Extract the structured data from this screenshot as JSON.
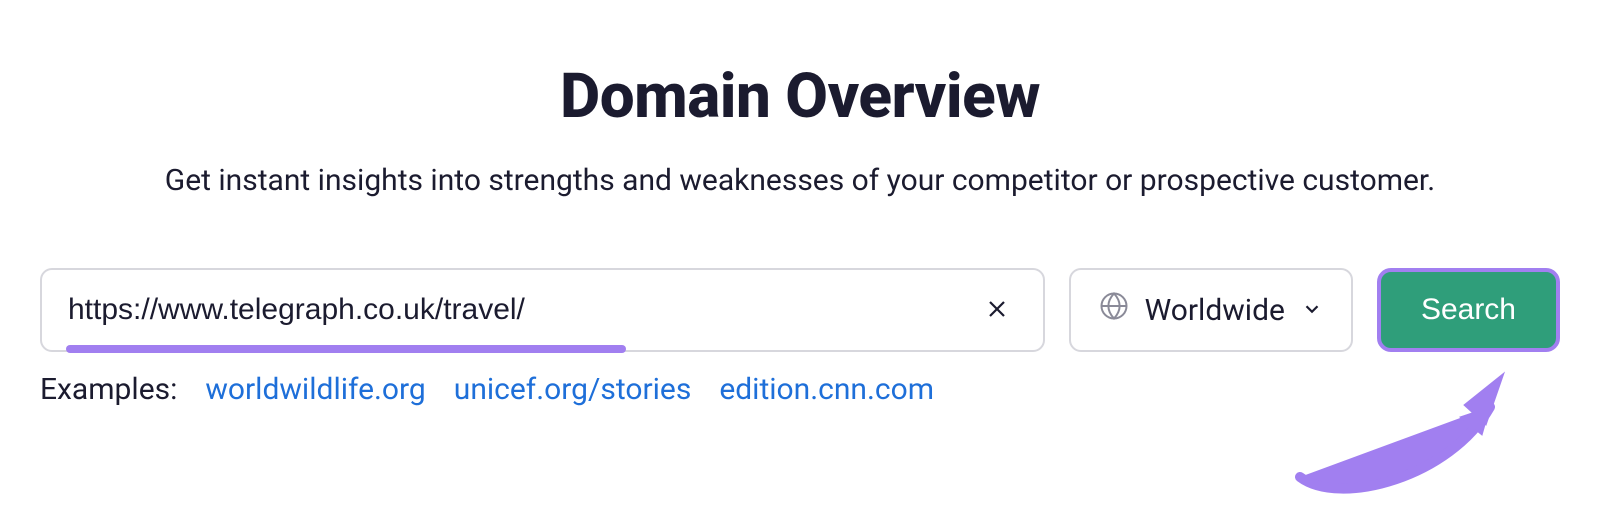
{
  "header": {
    "title": "Domain Overview",
    "subtitle": "Get instant insights into strengths and weaknesses of your competitor or prospective customer."
  },
  "search": {
    "input_value": "https://www.telegraph.co.uk/travel/",
    "locale_label": "Worldwide",
    "button_label": "Search"
  },
  "examples": {
    "label": "Examples:",
    "items": [
      "worldwildlife.org",
      "unicef.org/stories",
      "edition.cnn.com"
    ]
  },
  "colors": {
    "accent_green": "#2f9e7a",
    "annotation_purple": "#a17ff0",
    "link_blue": "#1e6fd9"
  }
}
